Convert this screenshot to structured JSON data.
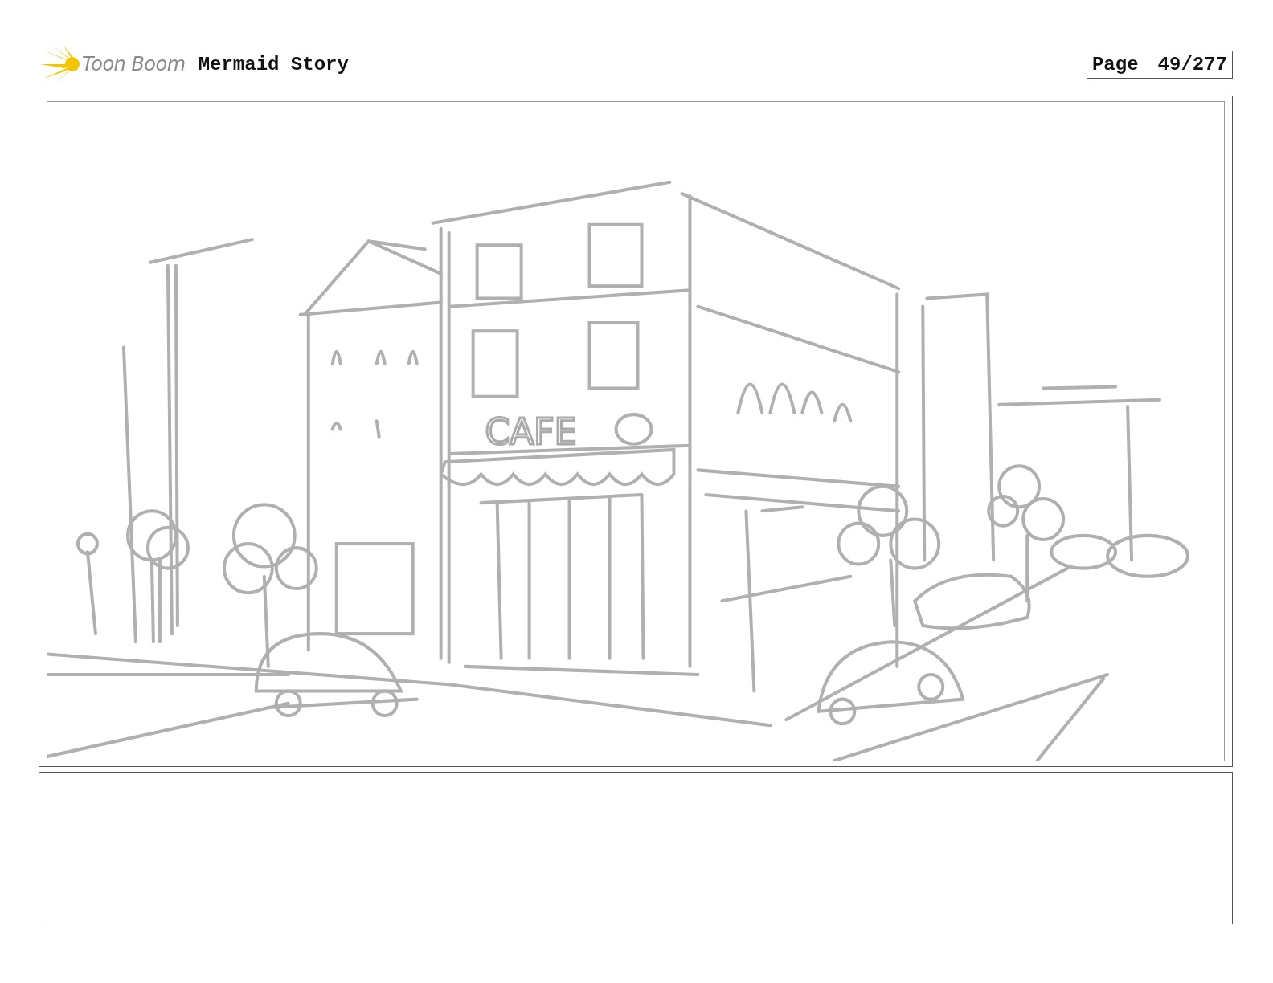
{
  "header": {
    "logo": "Toon Boom",
    "title": "Mermaid Story",
    "page_label": "Page",
    "page_number": "49/277"
  },
  "panel": {
    "sign_text": "CAFE"
  }
}
